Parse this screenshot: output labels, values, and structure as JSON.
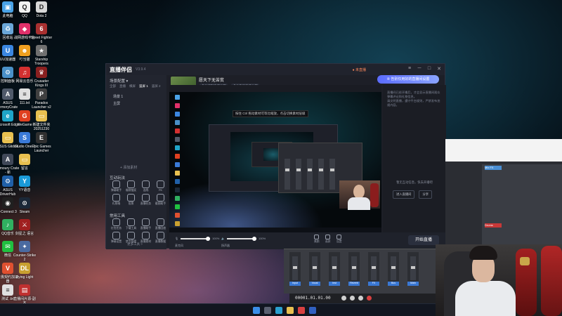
{
  "desktop_icons": [
    {
      "label": "此电脑",
      "glyph": "▣",
      "color": "#4aa3e8"
    },
    {
      "label": "QQ",
      "glyph": "Q",
      "color": "#f2f2f2"
    },
    {
      "label": "Dota 2",
      "glyph": "D",
      "color": "#d7d7d7"
    },
    {
      "label": "回收站",
      "glyph": "♻",
      "color": "#6aa6d8"
    },
    {
      "label": "战网游戏平台",
      "glyph": "◆",
      "color": "#e0306a"
    },
    {
      "label": "Street Fighter 6",
      "glyph": "6",
      "color": "#a83030"
    },
    {
      "label": "UU加速器",
      "glyph": "U",
      "color": "#3b86e0"
    },
    {
      "label": "叮当猫",
      "glyph": "☻",
      "color": "#f0a020"
    },
    {
      "label": "Starship Troopers",
      "glyph": "★",
      "color": "#707070"
    },
    {
      "label": "控制面板",
      "glyph": "⚙",
      "color": "#4a90c8"
    },
    {
      "label": "网易云音乐",
      "glyph": "♫",
      "color": "#d33030"
    },
    {
      "label": "Crusader Kings III",
      "glyph": "♛",
      "color": "#8a2020"
    },
    {
      "label": "ASUS ArmoryCrate",
      "glyph": "A",
      "color": "#505a6a"
    },
    {
      "label": "111.txt",
      "glyph": "≡",
      "color": "#e0e0e0"
    },
    {
      "label": "Paradox Launcher v2",
      "glyph": "P",
      "color": "#404040"
    },
    {
      "label": "Microsoft Edge",
      "glyph": "e",
      "color": "#1fa4c8"
    },
    {
      "label": "WeGame",
      "glyph": "G",
      "color": "#e04020"
    },
    {
      "label": "新建文件夹 20251230",
      "glyph": "▭",
      "color": "#e8c050"
    },
    {
      "label": "ASUS GlideX",
      "glyph": "▭",
      "color": "#e8c050"
    },
    {
      "label": "Studio One 7",
      "glyph": "S",
      "color": "#3a7ad8"
    },
    {
      "label": "Epic Games Launcher",
      "glyph": "E",
      "color": "#303030"
    },
    {
      "label": "Armoury Crate - 新",
      "glyph": "A",
      "color": "#404858"
    },
    {
      "label": "留言",
      "glyph": "▭",
      "color": "#e8c050"
    },
    {
      "label": "ASUS DriverHub",
      "glyph": "⚙",
      "color": "#2060a8"
    },
    {
      "label": "YY语音",
      "glyph": "Y",
      "color": "#1a9ad8"
    },
    {
      "label": "i-Connect 3",
      "glyph": "◉",
      "color": "#202020"
    },
    {
      "label": "Steam",
      "glyph": "⊙",
      "color": "#1b2838"
    },
    {
      "label": "QQ音乐",
      "glyph": "♪",
      "color": "#30b060"
    },
    {
      "label": "剑星之 语言",
      "glyph": "⚔",
      "color": "#a02020"
    },
    {
      "label": "微信",
      "glyph": "✉",
      "color": "#20c040"
    },
    {
      "label": "Counter-Strike 2",
      "glyph": "✦",
      "color": "#4a6aa0"
    },
    {
      "label": "无畏契约加速器",
      "glyph": "V",
      "color": "#e05030"
    },
    {
      "label": "Dying Light",
      "glyph": "DL",
      "color": "#c8a030"
    },
    {
      "label": "测试 .txt",
      "glyph": "≡",
      "color": "#e0e0e0"
    },
    {
      "label": "直播间片源-副本",
      "glyph": "▤",
      "color": "#c03030"
    }
  ],
  "app": {
    "name": "直播伴侣",
    "version": "V3.9.4",
    "room_title": "愿天下无苦贫",
    "room_tags": [
      "点此编辑直播标题",
      "点此选择直播分区"
    ],
    "live_status": "● 未直播",
    "banner_text": "④ 告别仅用好的直播间设置",
    "window_controls": {
      "menu": "≡",
      "minimize": "─",
      "maximize": "□",
      "close": "✕"
    },
    "sidebar": {
      "scene_title": "场景配置 ▾",
      "tabs": [
        "全部",
        "直播",
        "横屏",
        "竖屏 1",
        "竖屏 2"
      ],
      "scenes": [
        "场景 1",
        "主屏"
      ],
      "add_source": "+ 添加素材",
      "tools_title": "互动玩法",
      "tools": [
        "弹幕助手",
        "福袋抽奖",
        "连线",
        "PK",
        "礼物墙",
        "投票",
        "直播任务",
        "截图助手"
      ],
      "more_title": "常用工具",
      "more": [
        "红包任务",
        "下载工具",
        "直播助手",
        "直播回放",
        "弹幕设置",
        "禁言管理",
        "直播素材",
        "直播数据"
      ],
      "more_link": "更多工具 >"
    },
    "preview_hint": "按住 Ctrl 拖动素材可等比缩放，点击切换素材层级",
    "chat": {
      "lines": [
        "直播间已经开播后，才会显示直播间观众弹幕评论和礼物信息。",
        "请文明直播，遵守平台规则，严禁发布违规内容。"
      ],
      "promo": "暂无互动信息，快去开播吧",
      "buttons": [
        "进入直播间",
        "分享"
      ]
    },
    "bottom": {
      "mic_label": "麦克风",
      "mic_pct": "100%",
      "speaker_label": "扬声器",
      "speaker_pct": "100%",
      "tools": [
        "美颜",
        "画质",
        "设置"
      ],
      "start_button": "开始直播"
    }
  },
  "daw": {
    "time": "00001.01.01.00",
    "channels": [
      "Input",
      "Vocal",
      "Inst",
      "Reverb",
      "FX",
      "Bus",
      "Main"
    ]
  },
  "right_window": {
    "strip_labels": [
      "Mix FX",
      "Drums"
    ]
  }
}
